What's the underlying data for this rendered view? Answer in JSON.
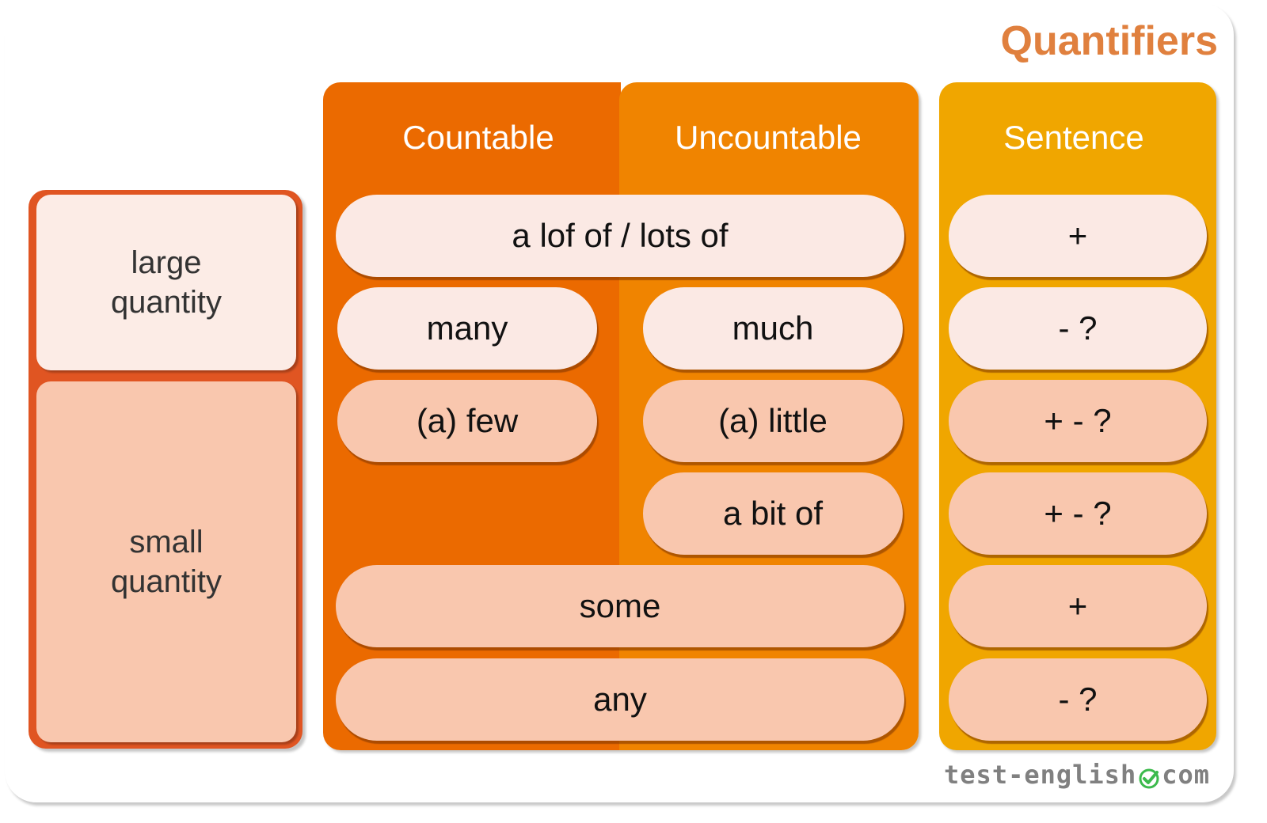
{
  "title": "Quantifiers",
  "quantity": {
    "large": "large quantity",
    "small": "small quantity"
  },
  "headers": {
    "countable": "Countable",
    "uncountable": "Uncountable",
    "sentence": "Sentence"
  },
  "quantifiers": {
    "a_lot_of": "a lof of / lots of",
    "many": "many",
    "much": "much",
    "a_few": "(a) few",
    "a_little": "(a) little",
    "a_bit_of": "a bit of",
    "some": "some",
    "any": "any"
  },
  "sentence_types": [
    "+",
    "- ?",
    "+ - ?",
    "+ - ?",
    "+",
    "- ?"
  ],
  "footer": {
    "brand_left": "test-english",
    "brand_right": "com",
    "check_icon": "green-check-circle-icon"
  },
  "colors": {
    "title": "#e0803e",
    "quantity_border": "#e05522",
    "countable_bg": "#eb6a00",
    "uncountable_bg": "#f08400",
    "sentence_bg": "#f0a600",
    "light_pill": "#fbe9e4",
    "peach_pill": "#f9c7ae",
    "check_green": "#3cba4c"
  }
}
